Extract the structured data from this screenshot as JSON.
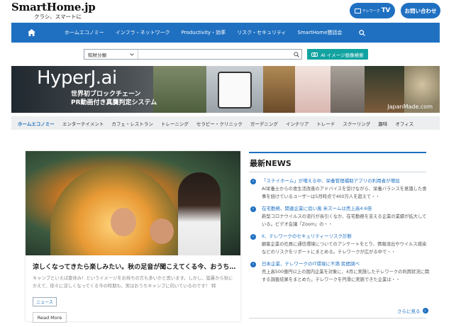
{
  "header": {
    "logo_title": "SmartHome.jp",
    "logo_sub": "クラシ、スマートに",
    "tv_small": "テレワーク",
    "tv_big": "TV",
    "contact": "お問い合わせ"
  },
  "nav": {
    "items": [
      "ホームエコノミー",
      "インフラ・ネットワーク",
      "Productivity・効率",
      "リスク・セキュリティ",
      "SmartHome懇話会"
    ]
  },
  "search": {
    "select_value": "知財分類",
    "input_value": "",
    "input_placeholder": "",
    "ai_button": "AI イメージ画像検索"
  },
  "banner": {
    "title": "HyperJ.ai",
    "sub_line1": "世界初ブロックチェーン",
    "sub_line2": "PR動画付き真贋判定システム",
    "url": "JapanMade.com"
  },
  "categories": [
    "ホームエコノミー",
    "エンターテイメント",
    "カフェ・レストラン",
    "トレーニング",
    "セラピー・クリニック",
    "ガーデニング",
    "インテリア",
    "トレード",
    "スクーリング",
    "趣味",
    "オフィス"
  ],
  "article": {
    "title": "涼しくなってきたら楽しみたい。秋の足音が聞こえてくる今、おうちキャンプ",
    "excerpt": "キャンプといえば夏休み！というイメージをお持ちの方も多いかと思います。しかし、猛暑から秋にかえて、徐々に涼しくなってくる今の時期も、実はおうちキャンプに向いているのです！ 特",
    "tag": "ニュース",
    "read_more": "Read More"
  },
  "news": {
    "heading": "最新NEWS",
    "items": [
      {
        "title": "「ステイホーム」が増える中、栄養管理補助アプリの利用者が増加",
        "body": "AI栄養士からの食生活改善のアドバイスを受けながら、栄養バランスを意識した食事を続けているユーザーは5月時点で400万人を超えて・・"
      },
      {
        "title": "在宅勤務、関連企業に追い風 米ズームは売上高4.6倍",
        "body": "新型コロナウイルスの流行が長引くなか、在宅勤務を支える企業の業績が拡大している。ビデオ会議「Zoom」の・・"
      },
      {
        "title": "II、テレワークのセキュリティーリスク診断",
        "body": "顧客企業の社員に通信環境についてのアンケートをとり、情報流出やウイルス感染などのリスクをリポートにまとめる。テレワークが広がる中で・・"
      },
      {
        "title": "日本企業、テレワークのIT環境に不満 民間調べ",
        "body": "売上高500億円以上の国内企業を対象に、4月に実施したテレワークの利用状況に関する調査結果をまとめた。テレワークを円滑に実施できた企業は・・"
      }
    ],
    "more": "さらに見る"
  },
  "colors": {
    "brand": "#1f70c1",
    "ai": "#12a3a1"
  }
}
